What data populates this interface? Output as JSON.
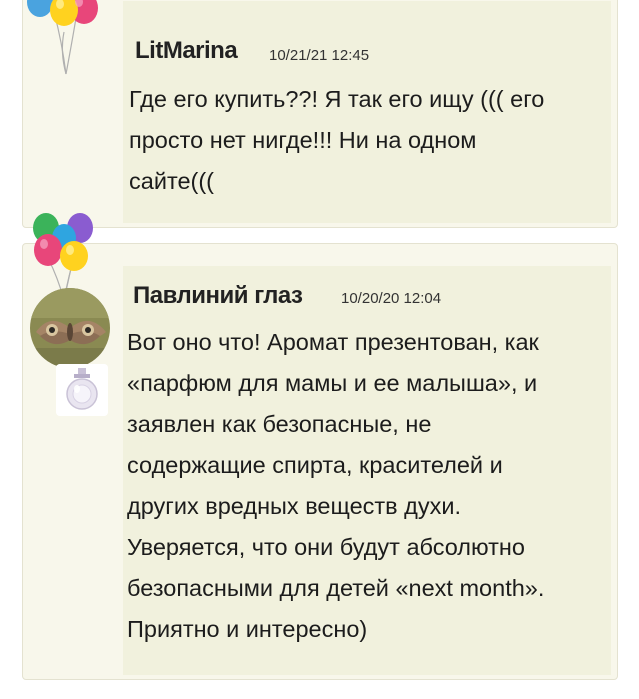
{
  "comments": [
    {
      "author": "LitMarina",
      "timestamp": "10/21/21 12:45",
      "text": "Где его купить??! Я так его ищу ((( его\nпросто нет нигде!!! Ни на одном\nсайте((("
    },
    {
      "author": "Павлиний глаз",
      "timestamp": "10/20/20 12:04",
      "text": "Вот оно что! Аромат презентован, как\n«парфюм для мамы и ее малыша», и\nзаявлен как безопасные, не\nсодержащие спирта, красителей и\nдругих вредных веществ духи.\nУверяется, что они будут абсолютно\nбезопасными для детей «next month».\nПриятно и интересно)"
    }
  ],
  "icons": {
    "balloons": "balloons-icon",
    "avatar": "moth-avatar",
    "badge": "perfume-bottle-icon"
  }
}
